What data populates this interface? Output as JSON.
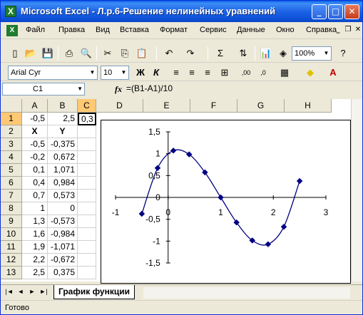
{
  "window": {
    "title": "Microsoft Excel - Л.р.6-Решение нелинейных уравнений"
  },
  "menu": [
    "Файл",
    "Правка",
    "Вид",
    "Вставка",
    "Формат",
    "Сервис",
    "Данные",
    "Окно",
    "Справка"
  ],
  "toolbar": {
    "zoom": "100%"
  },
  "format_toolbar": {
    "font": "Arial Cyr",
    "size": "10"
  },
  "formula_bar": {
    "cell_ref": "C1",
    "fx": "fx",
    "formula": "=(B1-A1)/10"
  },
  "columns": [
    "A",
    "B",
    "C",
    "D",
    "E",
    "F",
    "G",
    "H"
  ],
  "rows": [
    "1",
    "2",
    "3",
    "4",
    "5",
    "6",
    "7",
    "8",
    "9",
    "10",
    "11",
    "12",
    "13"
  ],
  "cells": {
    "A": [
      "-0,5",
      "X",
      "-0,5",
      "-0,2",
      "0,1",
      "0,4",
      "0,7",
      "1",
      "1,3",
      "1,6",
      "1,9",
      "2,2",
      "2,5"
    ],
    "B": [
      "2,5",
      "Y",
      "-0,375",
      "0,672",
      "1,071",
      "0,984",
      "0,573",
      "0",
      "-0,573",
      "-0,984",
      "-1,071",
      "-0,672",
      "0,375"
    ],
    "C1": "0,3"
  },
  "chart_data": {
    "type": "scatter",
    "x": [
      -0.5,
      -0.2,
      0.1,
      0.4,
      0.7,
      1.0,
      1.3,
      1.6,
      1.9,
      2.2,
      2.5
    ],
    "y": [
      -0.375,
      0.672,
      1.071,
      0.984,
      0.573,
      0.0,
      -0.573,
      -0.984,
      -1.071,
      -0.672,
      0.375
    ],
    "smooth_line": true,
    "xlim": [
      -1,
      3
    ],
    "ylim": [
      -1.5,
      1.5
    ],
    "x_ticks": [
      "-1",
      "0",
      "1",
      "2",
      "3"
    ],
    "y_ticks": [
      "1,5",
      "1",
      "0,5",
      "0",
      "-0,5",
      "-1",
      "-1,5"
    ],
    "series_color": "#000080",
    "grid": false
  },
  "sheet_tab": "График функции",
  "status": "Готово"
}
